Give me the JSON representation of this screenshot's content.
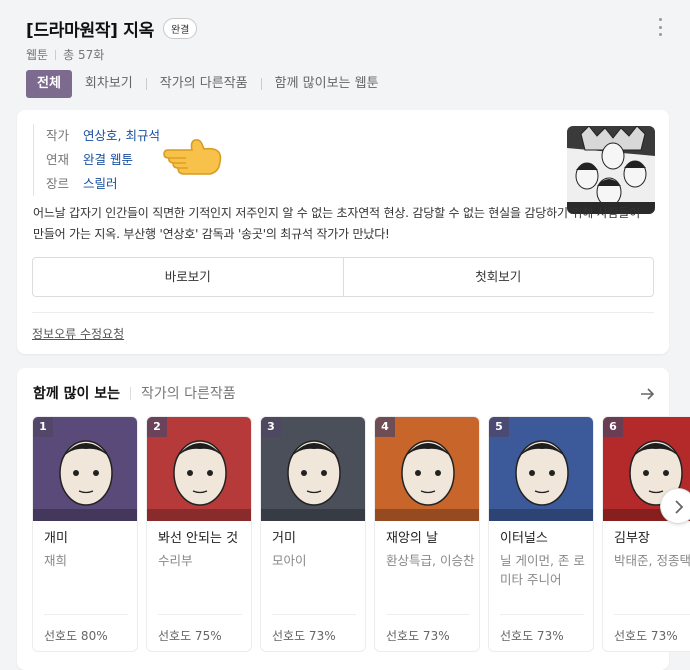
{
  "header": {
    "title": "[드라마원작] 지옥",
    "badge": "완결",
    "category": "웹툰",
    "episodes": "총 57화"
  },
  "tabs": [
    "전체",
    "회차보기",
    "작가의 다른작품",
    "함께 많이보는 웹툰"
  ],
  "info": {
    "rows": [
      {
        "label": "작가",
        "value": "연상호, 최규석"
      },
      {
        "label": "연재",
        "value": "완결 웹툰"
      },
      {
        "label": "장르",
        "value": "스릴러"
      }
    ],
    "description": "어느날 갑자기 인간들이 직면한 기적인지 저주인지 알 수 없는 초자연적 현상. 감당할 수 없는 현실을 감당하기 위해 사람들이 만들어 가는 지옥. 부산행 '연상호' 감독과 '송곳'의 최규석 작가가 만났다!",
    "buttons": {
      "read": "바로보기",
      "first": "첫회보기"
    },
    "report_link": "정보오류 수정요청"
  },
  "recommend": {
    "tab_active": "함께 많이 보는",
    "tab_other": "작가의 다른작품",
    "items": [
      {
        "rank": "1",
        "title": "개미",
        "author": "재희",
        "pref": "선호도 80%",
        "color": "#5a4a7a"
      },
      {
        "rank": "2",
        "title": "봐선 안되는 것",
        "author": "수리부",
        "pref": "선호도 75%",
        "color": "#b73a3a"
      },
      {
        "rank": "3",
        "title": "거미",
        "author": "모아이",
        "pref": "선호도 73%",
        "color": "#4a4f5a"
      },
      {
        "rank": "4",
        "title": "재앙의 날",
        "author": "환상특급, 이승찬",
        "pref": "선호도 73%",
        "color": "#c7652a"
      },
      {
        "rank": "5",
        "title": "이터널스",
        "author": "닐 게이먼, 존 로미타 주니어",
        "pref": "선호도 73%",
        "color": "#3c5a9a"
      },
      {
        "rank": "6",
        "title": "김부장",
        "author": "박태준, 정종택",
        "pref": "선호도 73%",
        "color": "#b42a2a"
      }
    ]
  }
}
